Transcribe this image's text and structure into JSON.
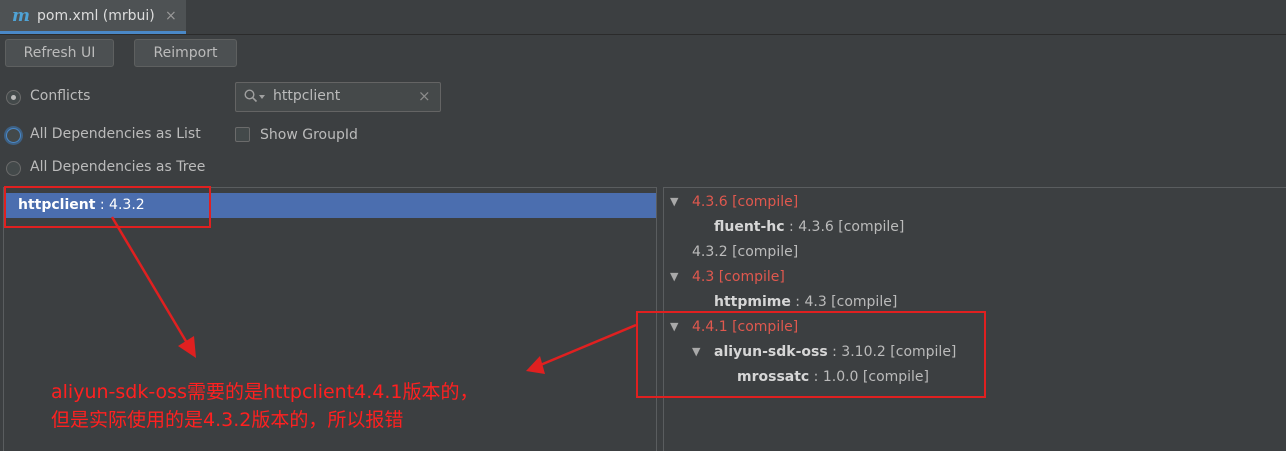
{
  "tab": {
    "icon": "m",
    "title": "pom.xml (mrbui)",
    "close": "×"
  },
  "toolbar": {
    "refresh_label": "Refresh UI",
    "reimport_label": "Reimport"
  },
  "view_options": {
    "conflicts_label": "Conflicts",
    "all_list_label": "All Dependencies as List",
    "all_tree_label": "All Dependencies as Tree",
    "selected": "Conflicts"
  },
  "search": {
    "value": "httpclient",
    "clear": "×"
  },
  "show_groupid": {
    "label": "Show GroupId",
    "checked": false
  },
  "left_list": {
    "items": [
      {
        "name": "httpclient",
        "version": " : 4.3.2"
      }
    ]
  },
  "right_tree": {
    "rows": [
      {
        "arrow": "▼",
        "text": "4.3.6 [compile]"
      },
      {
        "name": "fluent-hc",
        "text": " : 4.3.6 [compile]"
      },
      {
        "text": "4.3.2 [compile]"
      },
      {
        "arrow": "▼",
        "text": "4.3 [compile]"
      },
      {
        "name": "httpmime",
        "text": " : 4.3 [compile]"
      },
      {
        "arrow": "▼",
        "text": "4.4.1 [compile]"
      },
      {
        "arrow": "▼",
        "name": "aliyun-sdk-oss",
        "text": " : 3.10.2 [compile]"
      },
      {
        "name": "mrossatc",
        "text": " : 1.0.0 [compile]"
      }
    ]
  },
  "annotation": {
    "line1": "aliyun-sdk-oss需要的是httpclient4.4.1版本的，",
    "line2": "但是实际使用的是4.3.2版本的，所以报错"
  },
  "colors": {
    "annotation": "#ff2020",
    "conflict_version": "#e0584e",
    "selection": "#4b6eaf"
  }
}
